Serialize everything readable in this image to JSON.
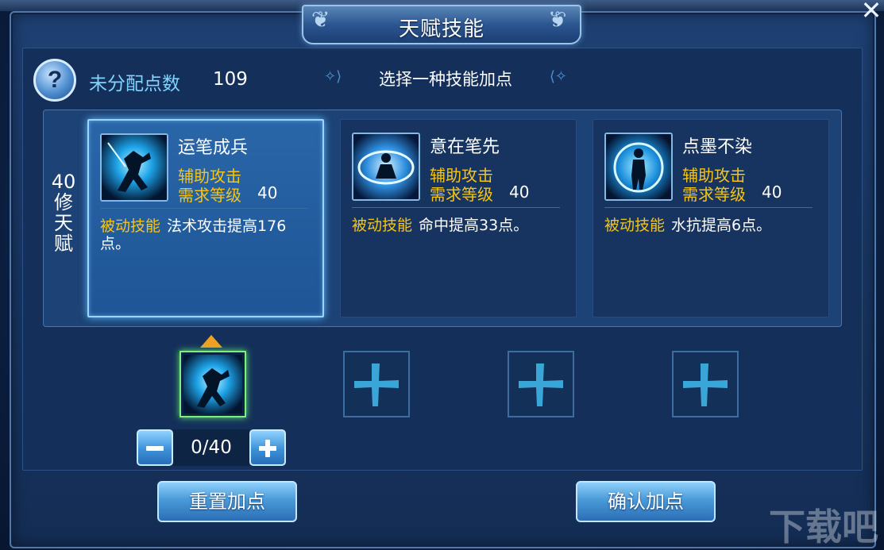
{
  "window": {
    "title": "天赋技能",
    "close_symbol": "✕"
  },
  "header": {
    "help_symbol": "?",
    "points_label": "未分配点数",
    "points_value": "109",
    "hint": "选择一种技能加点"
  },
  "tier": {
    "label": "40修天赋"
  },
  "cards": [
    {
      "name": "运笔成兵",
      "type": "辅助攻击",
      "req_label": "需求等级",
      "req_value": "40",
      "desc_tag": "被动技能",
      "desc": "法术攻击提高176点。",
      "icon": "sword-figure-icon",
      "selected": true
    },
    {
      "name": "意在笔先",
      "type": "辅助攻击",
      "req_label": "需求等级",
      "req_value": "40",
      "desc_tag": "被动技能",
      "desc": "命中提高33点。",
      "icon": "meditation-aura-icon",
      "selected": false
    },
    {
      "name": "点墨不染",
      "type": "辅助攻击",
      "req_label": "需求等级",
      "req_value": "40",
      "desc_tag": "被动技能",
      "desc": "水抗提高6点。",
      "icon": "water-vortex-figure-icon",
      "selected": false
    }
  ],
  "slots": [
    {
      "state": "filled",
      "icon": "sword-figure-icon"
    },
    {
      "state": "empty",
      "icon": "add-slot-icon"
    },
    {
      "state": "empty",
      "icon": "add-slot-icon"
    },
    {
      "state": "empty",
      "icon": "add-slot-icon"
    }
  ],
  "stepper": {
    "value": "0/40"
  },
  "actions": {
    "reset_label": "重置加点",
    "confirm_label": "确认加点"
  },
  "watermark": "下载吧",
  "colors": {
    "accent_gold": "#f5c418",
    "label_cyan": "#7fd4ff",
    "selected_glow": "#9ad6ff",
    "filled_slot_border": "#7cf07c"
  }
}
